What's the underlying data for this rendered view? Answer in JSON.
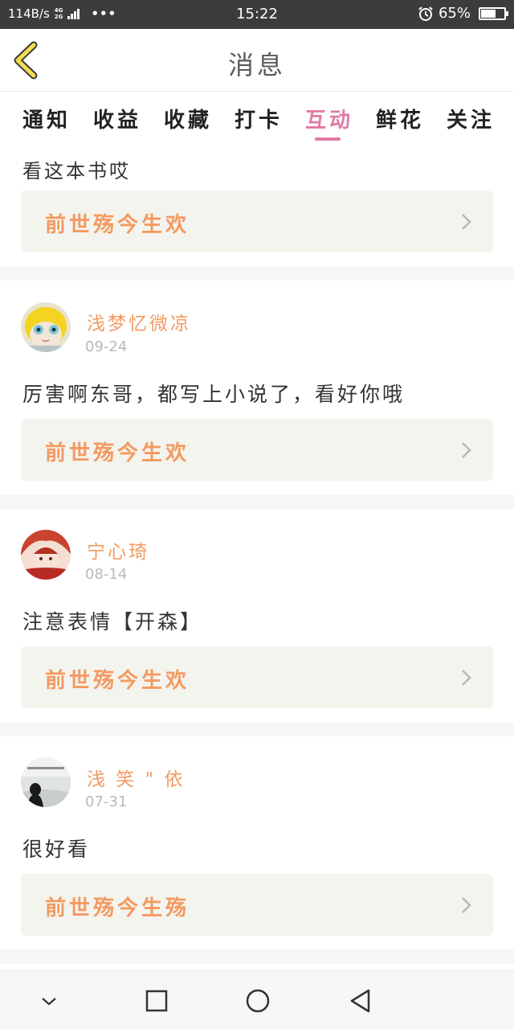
{
  "status_bar": {
    "speed": "114B/s",
    "net_top": "4G",
    "net_bottom": "2G",
    "dots": "•••",
    "time": "15:22",
    "battery_text": "65%",
    "battery_level": 0.65
  },
  "header": {
    "title": "消息",
    "back_icon": "chevron-left-icon"
  },
  "tabs": [
    {
      "label": "通知",
      "active": false
    },
    {
      "label": "收益",
      "active": false
    },
    {
      "label": "收藏",
      "active": false
    },
    {
      "label": "打卡",
      "active": false
    },
    {
      "label": "互动",
      "active": true
    },
    {
      "label": "鲜花",
      "active": false
    },
    {
      "label": "关注",
      "active": false
    }
  ],
  "partial_message": {
    "text": "看这本书哎",
    "book": "前世殇今生欢"
  },
  "messages": [
    {
      "user": "浅梦忆微凉",
      "date": "09-24",
      "text": "厉害啊东哥，都写上小说了，看好你哦",
      "book": "前世殇今生欢"
    },
    {
      "user": "宁心琦",
      "date": "08-14",
      "text": "注意表情【开森】",
      "book": "前世殇今生欢"
    },
    {
      "user": "浅 笑 \" 依",
      "date": "07-31",
      "text": "很好看",
      "book": "前世殇今生殇"
    }
  ],
  "colors": {
    "accent_pink": "#e27aa4",
    "accent_orange": "#f39a61",
    "back_icon_yellow": "#f2dc52"
  }
}
